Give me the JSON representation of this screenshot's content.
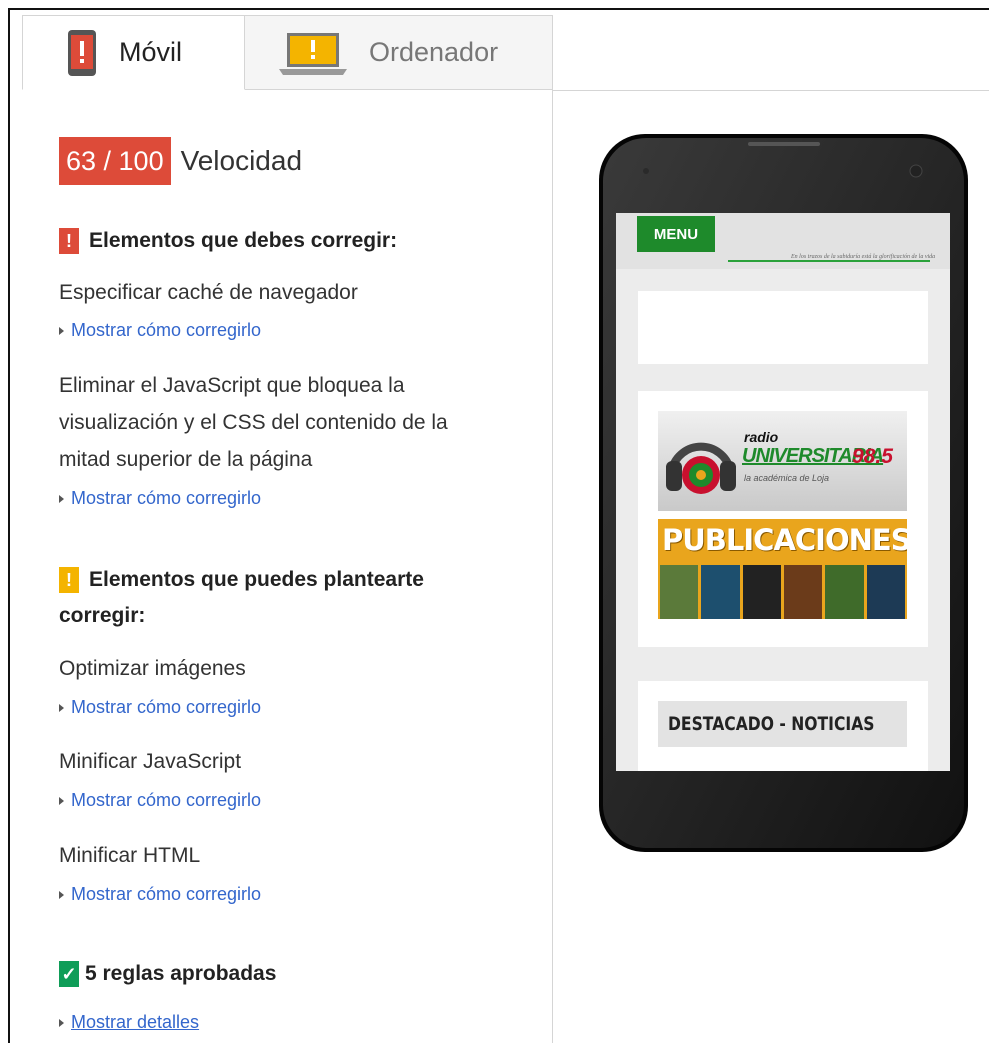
{
  "tabs": {
    "mobile": "Móvil",
    "desktop": "Ordenador"
  },
  "score": {
    "value": "63 / 100",
    "label": "Velocidad"
  },
  "must_fix": {
    "badge": "!",
    "title": "Elementos que debes corregir:",
    "rules": [
      {
        "lines": [
          "Especificar caché de navegador"
        ],
        "link": "Mostrar cómo corregirlo"
      },
      {
        "lines": [
          "Eliminar el JavaScript que bloquea la",
          "visualización y el CSS del contenido de la",
          "mitad superior de la página"
        ],
        "link": "Mostrar cómo corregirlo"
      }
    ]
  },
  "consider_fixing": {
    "badge": "!",
    "title_line1": "Elementos que puedes plantearte",
    "title_line2": "corregir:",
    "rules": [
      {
        "title": "Optimizar imágenes",
        "link": "Mostrar cómo corregirlo"
      },
      {
        "title": "Minificar JavaScript",
        "link": "Mostrar cómo corregirlo"
      },
      {
        "title": "Minificar HTML",
        "link": "Mostrar cómo corregirlo"
      }
    ]
  },
  "passed": {
    "badge": "✓",
    "title": "5 reglas aprobadas",
    "link": "Mostrar detalles"
  },
  "preview": {
    "menu": "MENU",
    "header_tagline": "En los trazos de la sabiduría está la glorificación de la vida",
    "radio_word": "radio",
    "radio_name": "UNIVERSITARIA",
    "radio_freq": "98.5",
    "radio_sub": "la académica de Loja",
    "publications": "PUBLICACIONES",
    "featured": "DESTACADO - NOTICIAS"
  },
  "colors": {
    "score_red": "#dd4b39",
    "warning_orange": "#f4b400",
    "pass_green": "#0f9d58",
    "link_blue": "#3366cc"
  }
}
